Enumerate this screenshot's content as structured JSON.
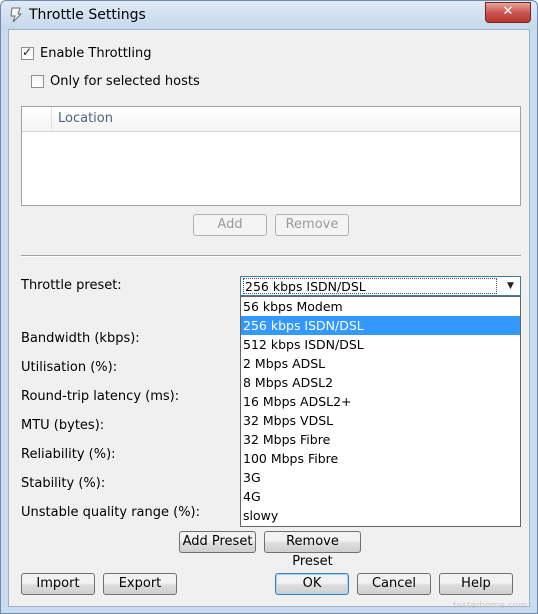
{
  "window": {
    "title": "Throttle Settings",
    "close_glyph": "✕",
    "icon": "throttle-app-icon"
  },
  "throttling": {
    "enable_label": "Enable Throttling",
    "enable_checked": true,
    "selected_hosts_label": "Only for selected hosts",
    "selected_hosts_checked": false
  },
  "hosts_list": {
    "column_header": "Location",
    "rows": []
  },
  "host_buttons": {
    "add": "Add",
    "remove": "Remove"
  },
  "preset": {
    "label": "Throttle preset:",
    "selected": "256 kbps ISDN/DSL",
    "options": [
      "56 kbps Modem",
      "256 kbps ISDN/DSL",
      "512 kbps ISDN/DSL",
      "2 Mbps ADSL",
      "8 Mbps ADSL2",
      "16 Mbps ADSL2+",
      "32 Mbps VDSL",
      "32 Mbps Fibre",
      "100 Mbps Fibre",
      "3G",
      "4G",
      "slowy"
    ],
    "selected_index": 1
  },
  "fields": {
    "bandwidth": "Bandwidth (kbps):",
    "utilisation": "Utilisation (%):",
    "latency": "Round-trip latency (ms):",
    "mtu": "MTU (bytes):",
    "reliability": "Reliability (%):",
    "stability": "Stability (%):",
    "unstable_range": "Unstable quality range (%):"
  },
  "preset_buttons": {
    "add": "Add Preset",
    "remove": "Remove Preset"
  },
  "footer": {
    "import": "Import",
    "export": "Export",
    "ok": "OK",
    "cancel": "Cancel",
    "help": "Help"
  },
  "watermark": "testerhome.com"
}
